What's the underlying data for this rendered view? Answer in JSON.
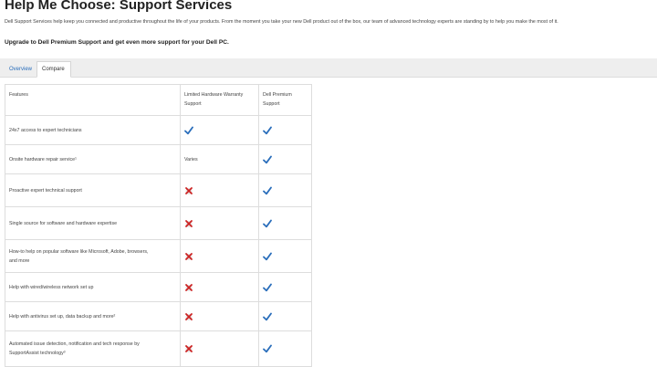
{
  "page": {
    "title": "Help Me Choose: Support Services",
    "intro": "Dell Support Services help keep you connected and productive throughout the life of your products. From the moment you take your new Dell product out of the box, our team of advanced technology experts are standing by to help you make the most of it.",
    "upgrade": "Upgrade to Dell Premium Support and get even more support for your Dell PC."
  },
  "tabs": [
    {
      "label": "Overview",
      "active": false
    },
    {
      "label": "Compare",
      "active": true
    }
  ],
  "table": {
    "headers": {
      "features": "Features",
      "col2_line1": "Limited Hardware Warranty",
      "col2_line2": "Support",
      "col3_line1": "Dell Premium",
      "col3_line2": "Support"
    },
    "rows": [
      {
        "feature_line1": "24x7 access to expert technicians",
        "feature_line2": "",
        "limited": "check-icon",
        "limited_text": "",
        "premium": "check-icon"
      },
      {
        "feature_line1": "Onsite hardware repair service¹",
        "feature_line2": "",
        "limited": "",
        "limited_text": "Varies",
        "premium": "check-icon"
      },
      {
        "feature_line1": "Proactive expert technical support",
        "feature_line2": "",
        "limited": "cross-icon",
        "limited_text": "",
        "premium": "check-icon"
      },
      {
        "feature_line1": "Single source for software and hardware expertise",
        "feature_line2": "",
        "limited": "cross-icon",
        "limited_text": "",
        "premium": "check-icon"
      },
      {
        "feature_line1": "How-to help on popular software like Microsoft, Adobe, browsers,",
        "feature_line2": "and more",
        "limited": "cross-icon",
        "limited_text": "",
        "premium": "check-icon"
      },
      {
        "feature_line1": "Help with wired/wireless network set up",
        "feature_line2": "",
        "limited": "cross-icon",
        "limited_text": "",
        "premium": "check-icon"
      },
      {
        "feature_line1": "Help with antivirus set up, data backup and more²",
        "feature_line2": "",
        "limited": "cross-icon",
        "limited_text": "",
        "premium": "check-icon"
      },
      {
        "feature_line1": "Automated issue detection, notification and tech response by",
        "feature_line2": "SupportAssist technology³",
        "limited": "cross-icon",
        "limited_text": "",
        "premium": "check-icon"
      }
    ]
  },
  "colors": {
    "check": "#2a6ebb",
    "cross": "#cc2222",
    "link": "#2a6ebb"
  }
}
